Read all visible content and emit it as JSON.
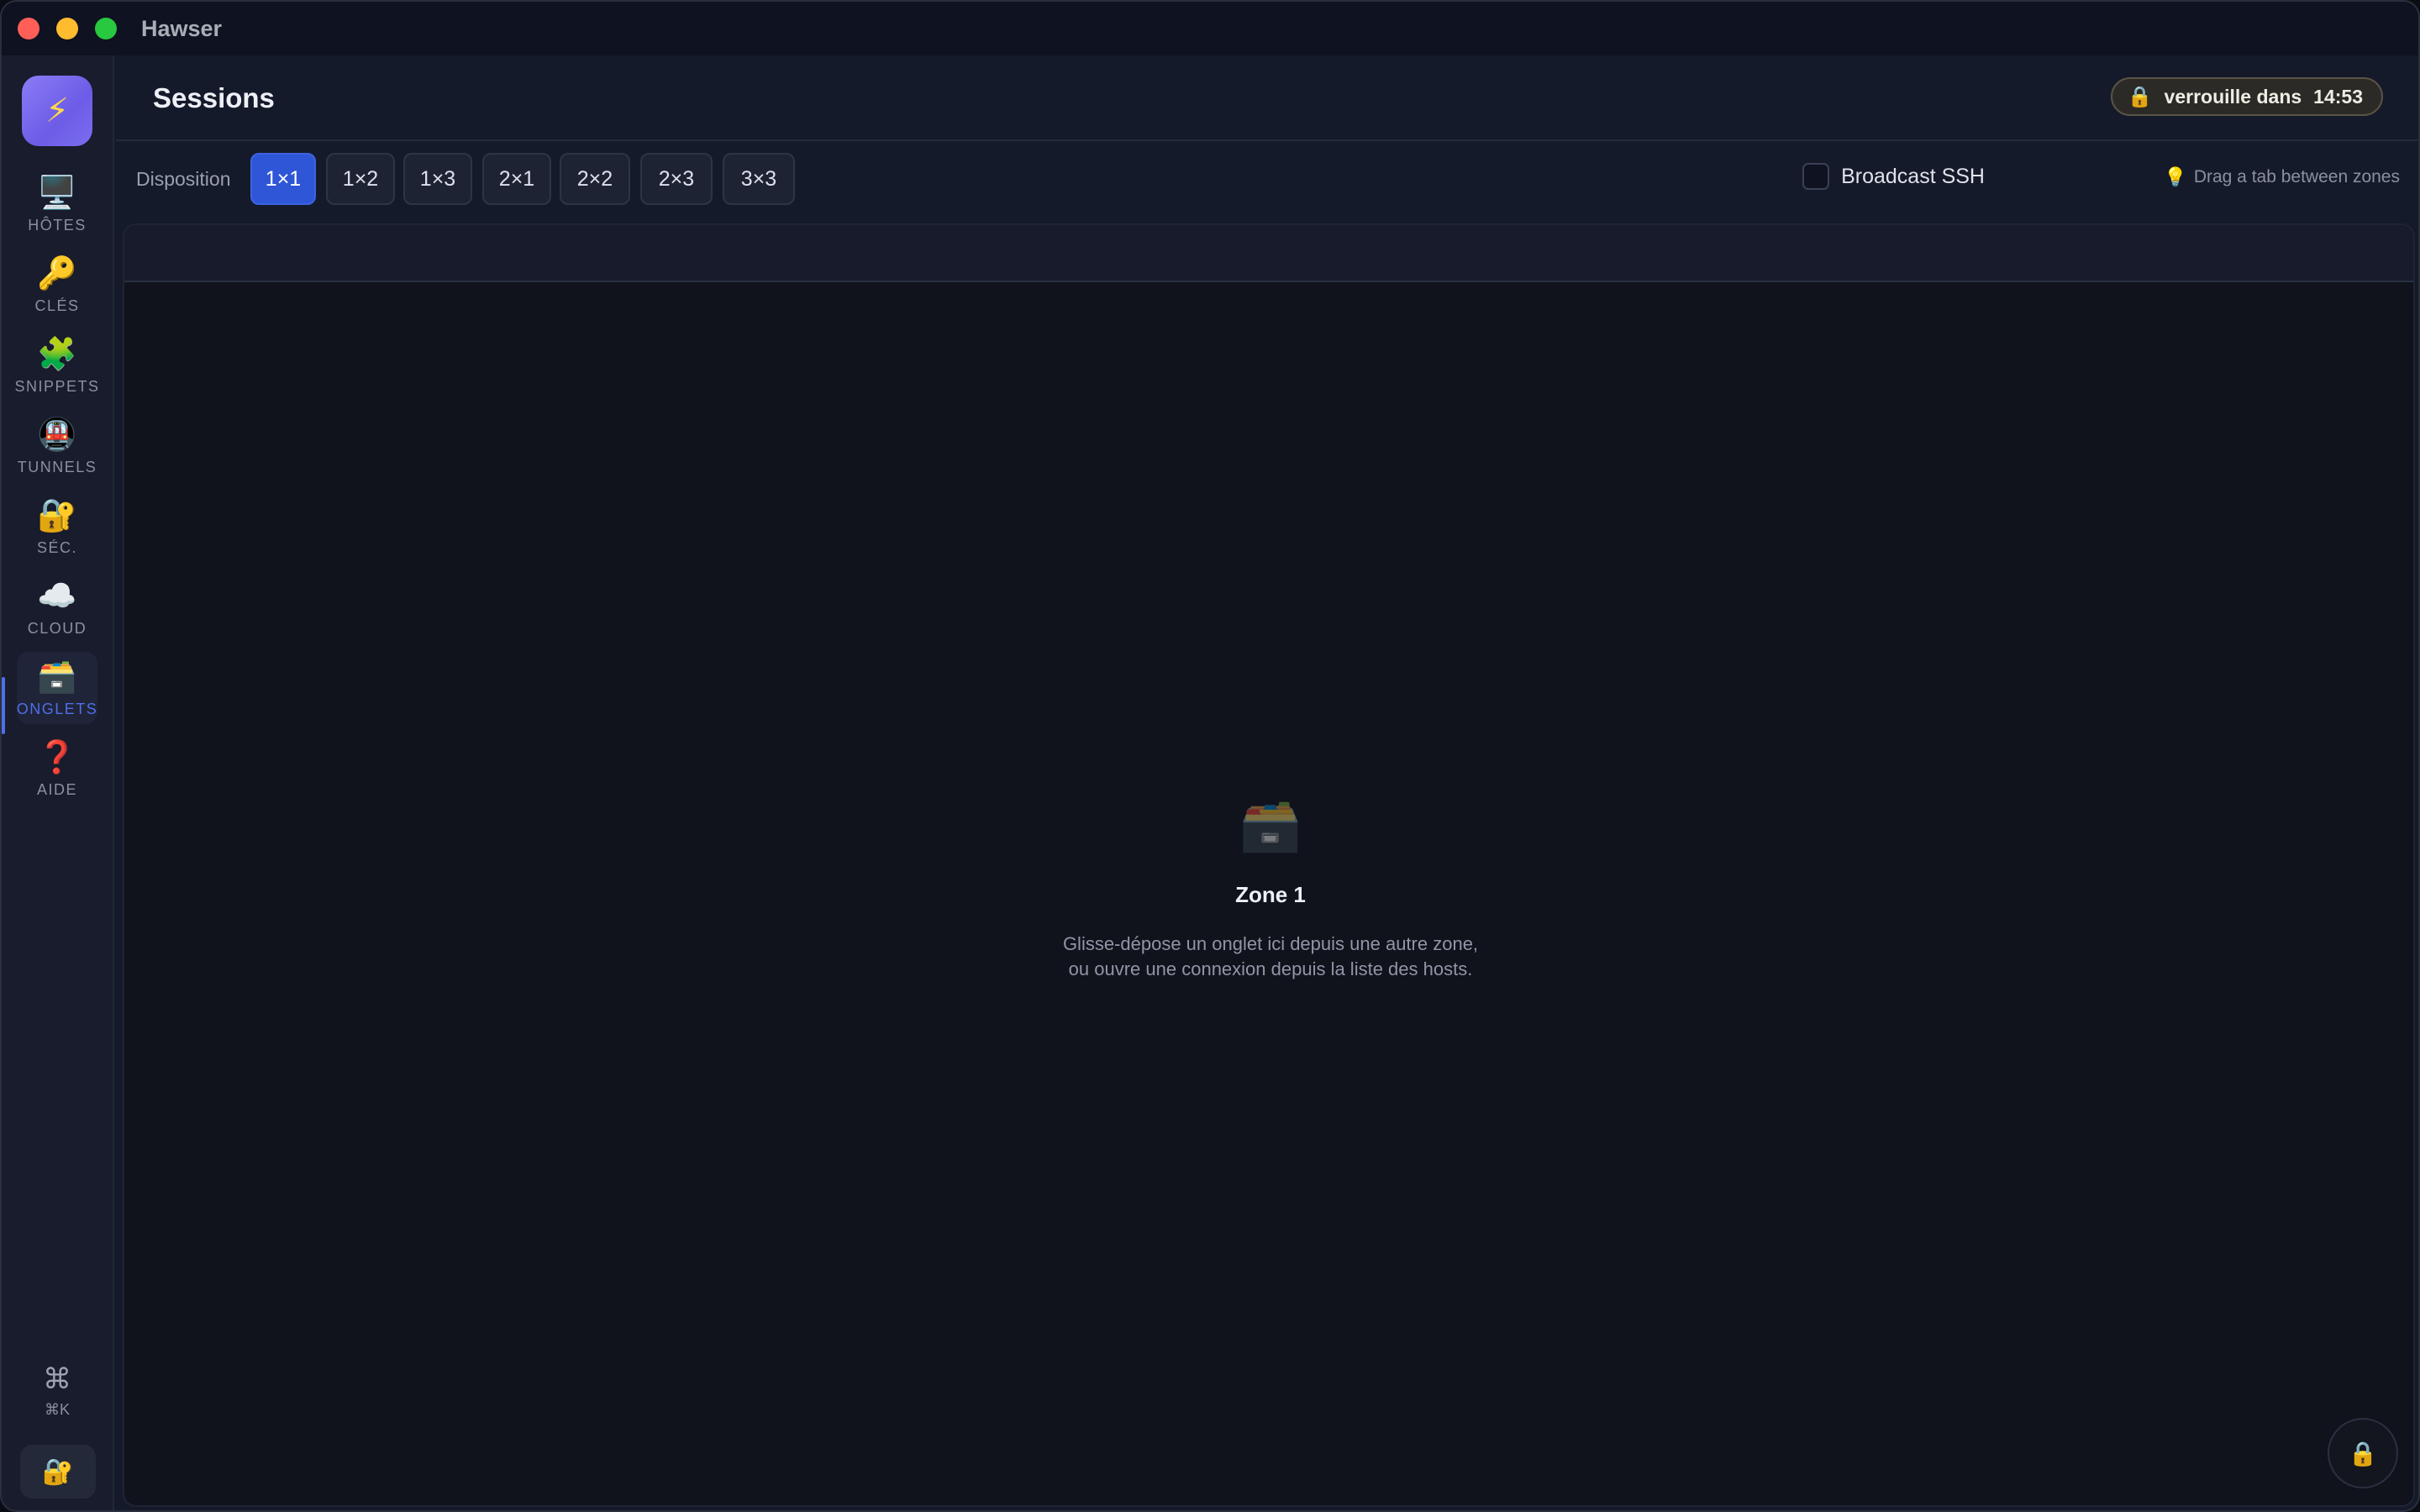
{
  "app": {
    "title": "Hawser"
  },
  "sidebar": {
    "logo_icon": "lightning-icon",
    "items": [
      {
        "icon": "🖥️",
        "icon_name": "monitor-icon",
        "label": "HÔTES"
      },
      {
        "icon": "🔑",
        "icon_name": "key-icon",
        "label": "CLÉS"
      },
      {
        "icon": "🧩",
        "icon_name": "puzzle-icon",
        "label": "SNIPPETS"
      },
      {
        "icon": "🚇",
        "icon_name": "tunnel-icon",
        "label": "TUNNELS"
      },
      {
        "icon": "🔐",
        "icon_name": "lock-key-icon",
        "label": "SÉC."
      },
      {
        "icon": "☁️",
        "icon_name": "cloud-icon",
        "label": "CLOUD"
      },
      {
        "icon": "🗃️",
        "icon_name": "card-box-icon",
        "label": "ONGLETS",
        "active": true
      },
      {
        "icon": "❓",
        "icon_name": "question-icon",
        "label": "AIDE"
      }
    ],
    "command": {
      "icon": "⌘",
      "label": "⌘K"
    },
    "lock_icon": "🔐"
  },
  "header": {
    "title": "Sessions",
    "lock_badge": {
      "icon": "🔒",
      "label": "verrouille dans",
      "time": "14:53"
    }
  },
  "toolbar": {
    "disposition_label": "Disposition",
    "layouts": [
      "1×1",
      "1×2",
      "1×3",
      "2×1",
      "2×2",
      "2×3",
      "3×3"
    ],
    "active_layout": "1×1",
    "broadcast_label": "Broadcast SSH",
    "broadcast_checked": false,
    "hint_icon": "💡",
    "hint_text": "Drag a tab between zones"
  },
  "zone": {
    "icon": "🗃️",
    "title": "Zone 1",
    "description": "Glisse-dépose un onglet ici depuis une autre zone, ou ouvre une connexion depuis la liste des hosts.",
    "lock_icon": "🔒"
  },
  "colors": {
    "accent": "#2f56d6",
    "active_nav_label": "#4f6fe8",
    "background": "#151a2a",
    "zone_background": "#10121c"
  }
}
